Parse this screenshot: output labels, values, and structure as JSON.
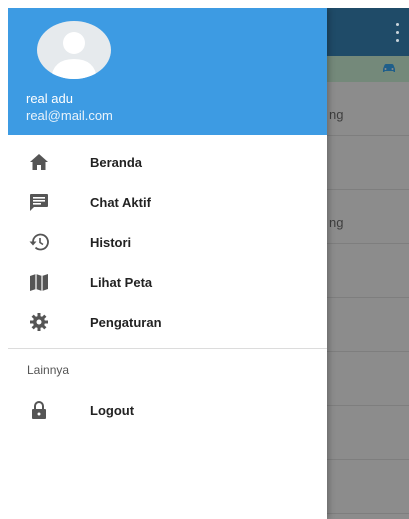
{
  "background": {
    "list_rows": [
      {
        "text": "ng"
      },
      {
        "text": ""
      },
      {
        "text": "ng"
      },
      {
        "text": ""
      },
      {
        "text": ""
      },
      {
        "text": ""
      },
      {
        "text": ""
      },
      {
        "text": ""
      }
    ],
    "icons": [
      "more-vert-icon",
      "car-icon"
    ]
  },
  "drawer": {
    "user": {
      "name": "real adu",
      "email": "real@mail.com"
    },
    "items": [
      {
        "label": "Beranda",
        "icon": "home-icon"
      },
      {
        "label": "Chat Aktif",
        "icon": "chat-icon"
      },
      {
        "label": "Histori",
        "icon": "history-icon"
      },
      {
        "label": "Lihat Peta",
        "icon": "map-icon"
      },
      {
        "label": "Pengaturan",
        "icon": "settings-icon"
      }
    ],
    "section": {
      "label": "Lainnya",
      "items": [
        {
          "label": "Logout",
          "icon": "lock-icon"
        }
      ]
    }
  },
  "colors": {
    "header_blue": "#3d9be3",
    "toolbar_dark": "#1f4b68",
    "icon_gray": "#555555"
  }
}
